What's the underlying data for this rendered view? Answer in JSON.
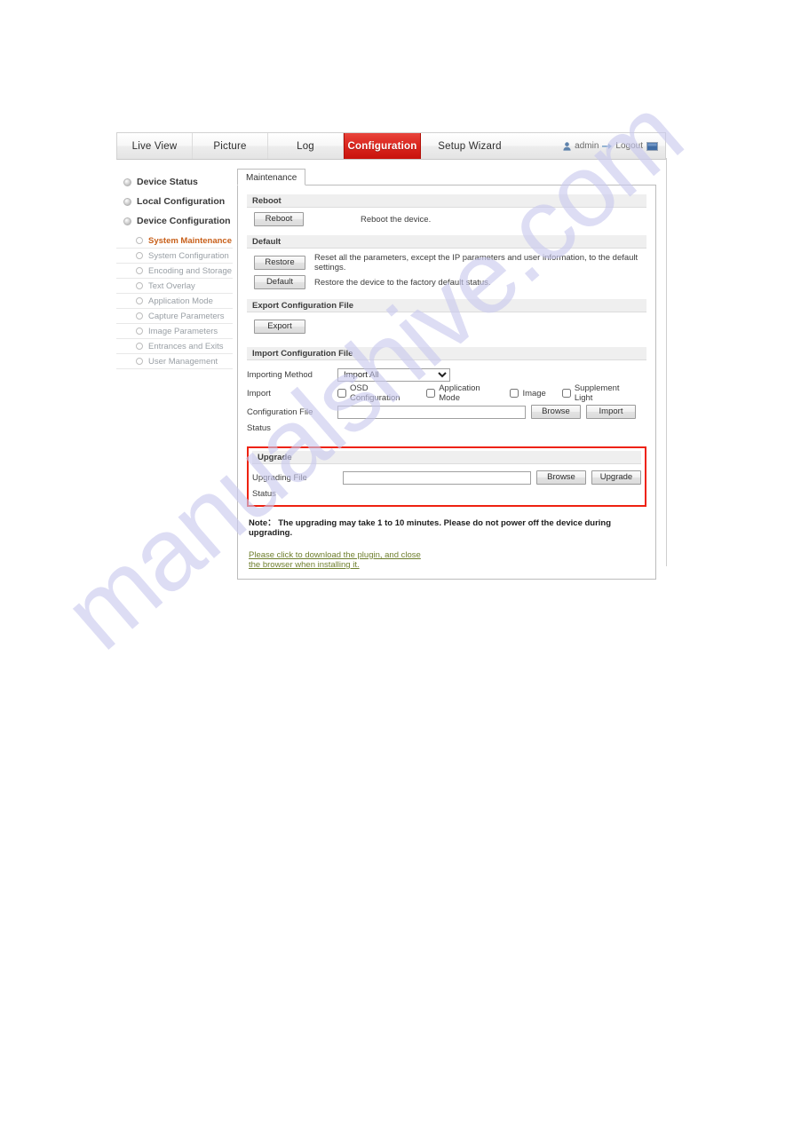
{
  "topnav": {
    "items": [
      {
        "label": "Live View",
        "active": false
      },
      {
        "label": "Picture",
        "active": false
      },
      {
        "label": "Log",
        "active": false
      },
      {
        "label": "Configuration",
        "active": true
      },
      {
        "label": "Setup Wizard",
        "active": false
      }
    ],
    "user": {
      "name": "admin",
      "logout": "Logout",
      "user_icon": "user-icon",
      "logout_icon": "logout-arrow-icon",
      "lang_icon": "language-flag-icon"
    },
    "active_color": "#c8120c"
  },
  "sidebar": {
    "groups": [
      {
        "label": "Device Status"
      },
      {
        "label": "Local Configuration"
      },
      {
        "label": "Device Configuration"
      }
    ],
    "items": [
      {
        "label": "System Maintenance",
        "active": true
      },
      {
        "label": "System Configuration",
        "active": false
      },
      {
        "label": "Encoding and Storage",
        "active": false
      },
      {
        "label": "Text Overlay",
        "active": false
      },
      {
        "label": "Application Mode",
        "active": false
      },
      {
        "label": "Capture Parameters",
        "active": false
      },
      {
        "label": "Image Parameters",
        "active": false
      },
      {
        "label": "Entrances and Exits",
        "active": false
      },
      {
        "label": "User Management",
        "active": false
      }
    ],
    "active_color": "#c8601a"
  },
  "tabs": [
    {
      "label": "Maintenance",
      "active": true
    }
  ],
  "sections": {
    "reboot": {
      "title": "Reboot",
      "button": "Reboot",
      "description": "Reboot the device."
    },
    "default": {
      "title": "Default",
      "restore_button": "Restore",
      "restore_description": "Reset all the parameters, except the IP parameters and user information, to the default settings.",
      "default_button": "Default",
      "default_description": "Restore the device to the factory default status."
    },
    "export": {
      "title": "Export Configuration File",
      "button": "Export"
    },
    "import": {
      "title": "Import Configuration File",
      "method_label": "Importing Method",
      "method_value": "Import All",
      "method_options": [
        "Import All"
      ],
      "import_label": "Import",
      "checkboxes": [
        {
          "label": "OSD Configuration",
          "checked": false
        },
        {
          "label": "Application Mode",
          "checked": false
        },
        {
          "label": "Image",
          "checked": false
        },
        {
          "label": "Supplement Light",
          "checked": false
        }
      ],
      "file_label": "Configuration File",
      "file_value": "",
      "file_placeholder": "",
      "browse_button": "Browse",
      "import_button": "Import",
      "status_label": "Status"
    },
    "upgrade": {
      "title": "Upgrade",
      "file_label": "Upgrading File",
      "file_value": "",
      "file_placeholder": "",
      "browse_button": "Browse",
      "upgrade_button": "Upgrade",
      "status_label": "Status",
      "highlight_color": "#ee2211"
    }
  },
  "note": "Note： The upgrading may take 1 to 10 minutes. Please do not power off the device during upgrading.",
  "plugin_link": "Please click to download the plugin, and close the browser when installing it.",
  "watermark": {
    "text": "manualshive.com"
  }
}
